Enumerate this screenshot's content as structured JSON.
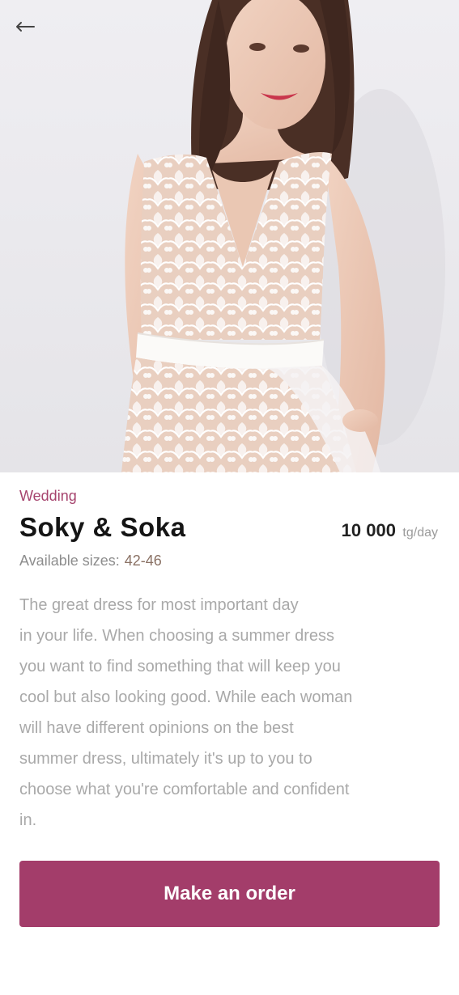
{
  "header": {
    "back_icon": "arrow-left-icon"
  },
  "hero": {
    "image_description_icon": "product-photo"
  },
  "product": {
    "category": "Wedding",
    "title": "Soky & Soka",
    "price": "10 000",
    "price_unit": "tg/day",
    "sizes_label": "Available sizes:",
    "sizes_value": "42-46",
    "description": "The great dress for most important day\nin your life. When choosing a summer dress\nyou want to find something that will keep you\ncool but also looking good. While each woman\nwill have different opinions on the best\nsummer dress, ultimately it's up to you to\nchoose what you're comfortable and confident\nin."
  },
  "actions": {
    "order_label": "Make an order"
  },
  "colors": {
    "accent": "#a33d6a",
    "category": "#a6446e",
    "title": "#151515",
    "body_text": "#a9a9a9"
  }
}
